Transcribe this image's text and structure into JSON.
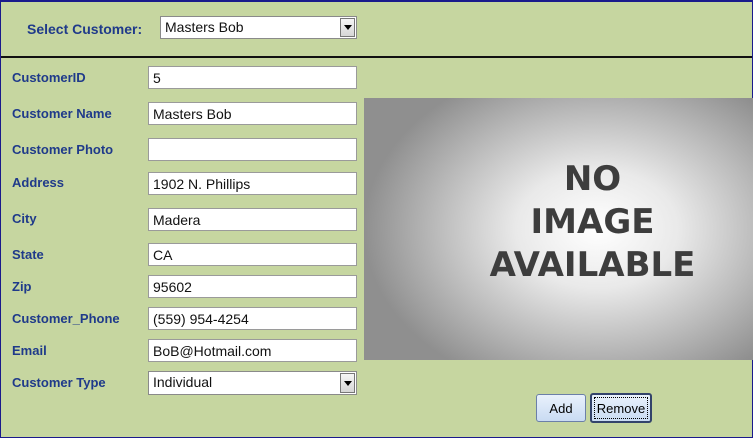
{
  "header": {
    "select_customer_label": "Select Customer:",
    "select_customer_value": "Masters Bob"
  },
  "form": {
    "customer_id": {
      "label": "CustomerID",
      "value": "5"
    },
    "customer_name": {
      "label": "Customer Name",
      "value": "Masters Bob"
    },
    "customer_photo": {
      "label": "Customer Photo",
      "value": ""
    },
    "address": {
      "label": "Address",
      "value": "1902 N. Phillips"
    },
    "city": {
      "label": "City",
      "value": "Madera"
    },
    "state": {
      "label": "State",
      "value": "CA"
    },
    "zip": {
      "label": "Zip",
      "value": "95602"
    },
    "customer_phone": {
      "label": "Customer_Phone",
      "value": "(559) 954-4254"
    },
    "email": {
      "label": "Email",
      "value": "BoB@Hotmail.com"
    },
    "customer_type": {
      "label": "Customer Type",
      "value": "Individual"
    }
  },
  "photo": {
    "placeholder_lines": [
      "NO",
      "IMAGE",
      "AVAILABLE"
    ]
  },
  "buttons": {
    "add_label": "Add",
    "remove_label": "Remove"
  },
  "colors": {
    "background": "#c6d6a0",
    "label_text": "#1f3a8a",
    "border": "#1a1a8c"
  },
  "icons": {
    "dropdown": "chevron-down-icon"
  }
}
